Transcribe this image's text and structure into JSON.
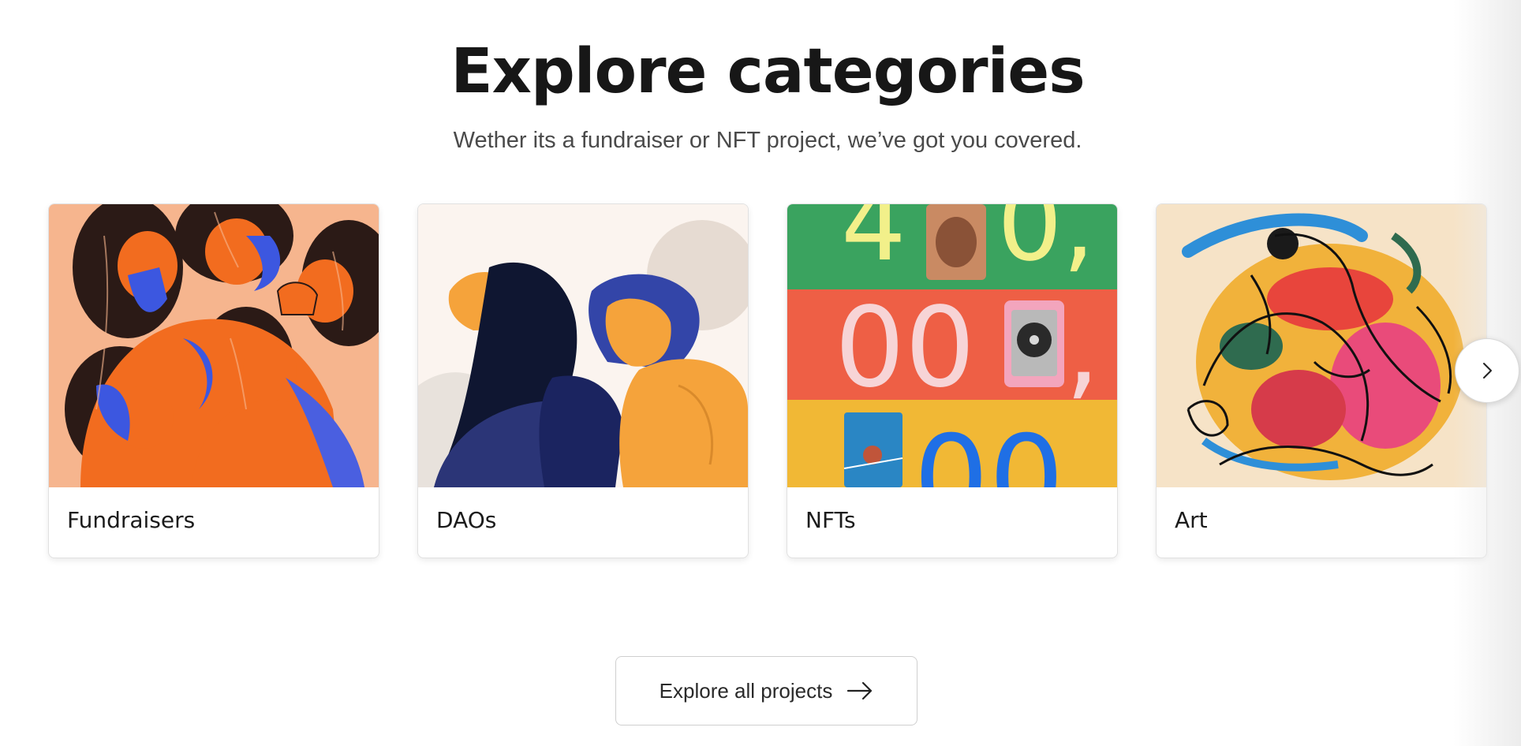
{
  "header": {
    "title": "Explore categories",
    "subtitle": "Wether its a fundraiser or NFT project, we’ve got you covered."
  },
  "categories": [
    {
      "label": "Fundraisers"
    },
    {
      "label": "DAOs"
    },
    {
      "label": "NFTs",
      "artwork_text": {
        "row1": [
          "4",
          "0,"
        ],
        "row2": [
          "00",
          ","
        ],
        "row3": [
          "00"
        ]
      }
    },
    {
      "label": "Art"
    }
  ],
  "carousel": {
    "next_icon": "chevron-right-icon"
  },
  "footer": {
    "explore_label": "Explore all projects",
    "explore_icon": "arrow-right-icon"
  },
  "colors": {
    "title": "#171717",
    "subtitle": "#4a4a4a",
    "nft_green": "#3aa35f",
    "nft_red": "#ee5f45",
    "nft_yellow": "#f1b835",
    "nft_blue": "#1f6fe5",
    "orange": "#f26c1f",
    "blue": "#3c57e0"
  }
}
